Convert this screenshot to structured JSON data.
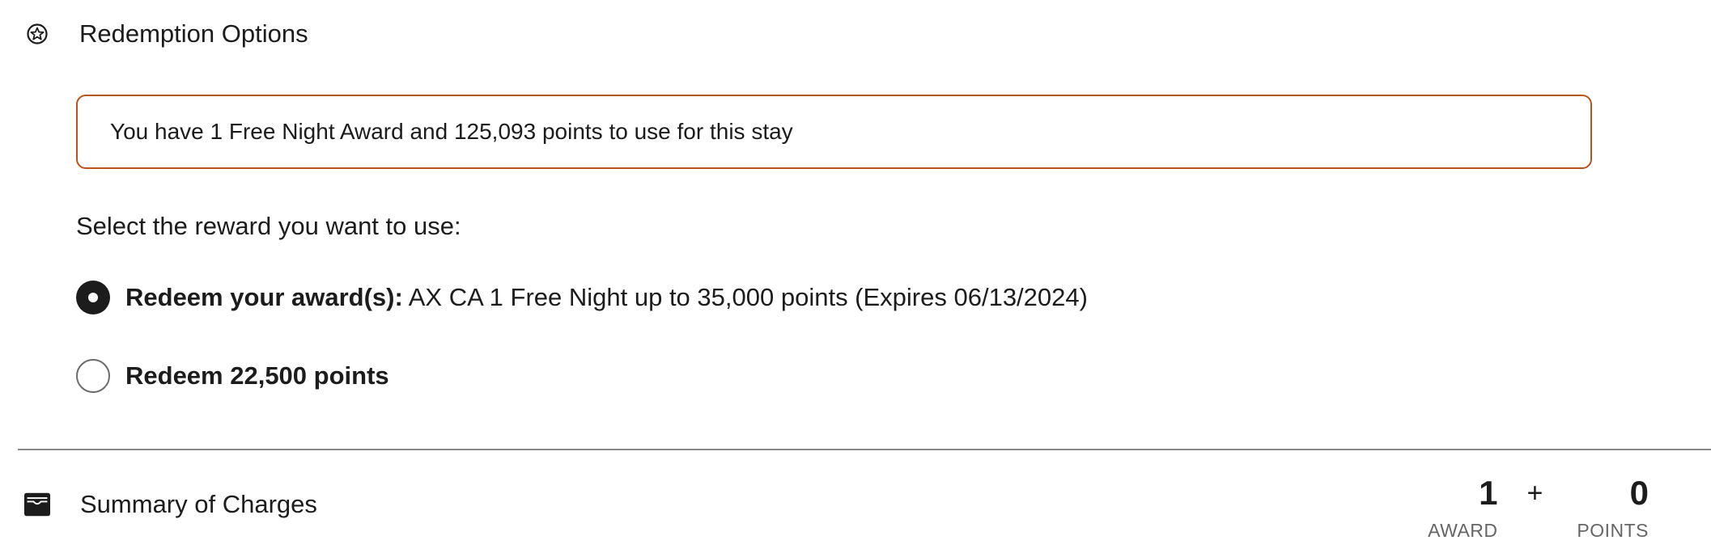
{
  "redemption": {
    "icon": "star-circle-icon",
    "title": "Redemption Options",
    "info_text": "You have 1 Free Night Award and 125,093 points to use for this stay",
    "prompt": "Select the reward you want to use:",
    "options": [
      {
        "bold_label": "Redeem your award(s):",
        "detail": " AX CA 1 Free Night up to 35,000 points (Expires 06/13/2024)",
        "selected": true
      },
      {
        "bold_label": "Redeem 22,500 points",
        "detail": "",
        "selected": false
      }
    ]
  },
  "summary": {
    "icon": "wallet-icon",
    "title": "Summary of Charges",
    "award_value": "1",
    "award_label": "AWARD",
    "plus": "+",
    "points_value": "0",
    "points_label": "POINTS"
  },
  "colors": {
    "accent_border": "#b8541a",
    "text": "#1c1c1c",
    "muted": "#666666"
  }
}
